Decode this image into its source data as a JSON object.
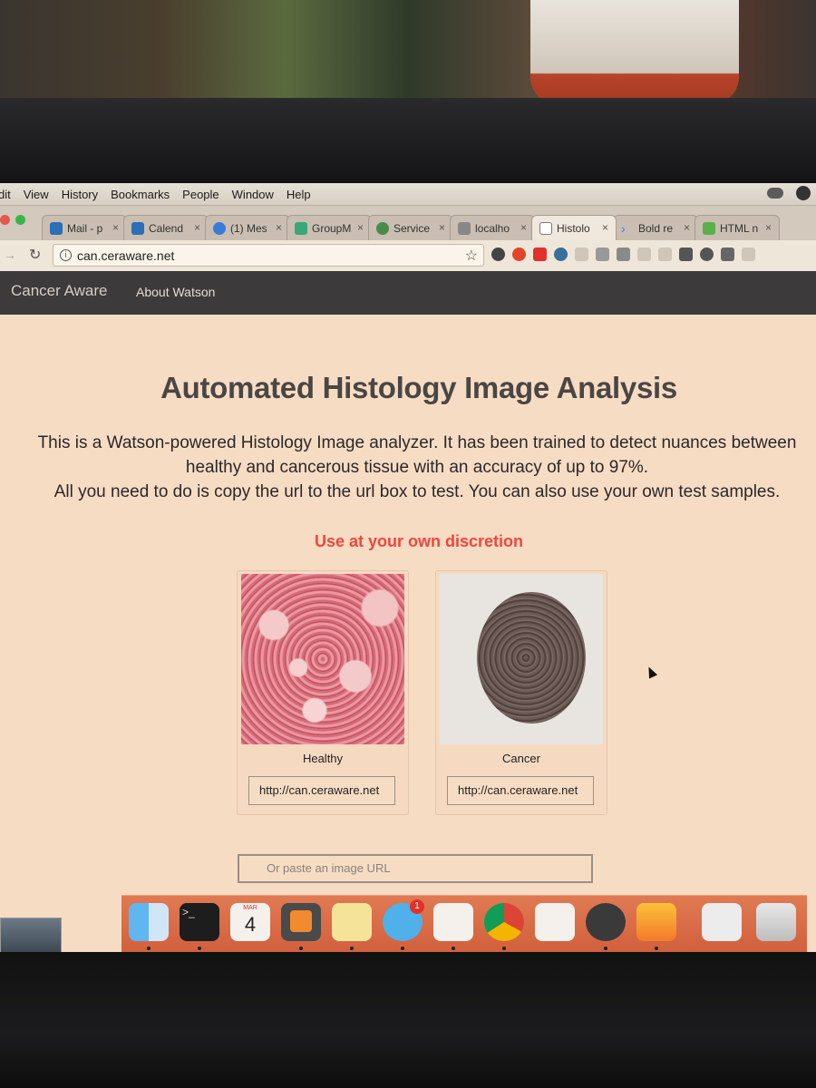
{
  "menubar": {
    "items": [
      "dit",
      "View",
      "History",
      "Bookmarks",
      "People",
      "Window",
      "Help"
    ]
  },
  "tabs": [
    {
      "label": "Mail - p",
      "favicon_color": "#2a6fb8"
    },
    {
      "label": "Calend",
      "favicon_color": "#2a6fb8"
    },
    {
      "label": "(1) Mes",
      "favicon_color": "#3b7bd8"
    },
    {
      "label": "GroupM",
      "favicon_color": "#3aa67a"
    },
    {
      "label": "Service",
      "favicon_color": "#4a8a4a"
    },
    {
      "label": "localho",
      "favicon_color": "#888888"
    },
    {
      "label": "Histolo",
      "favicon_color": "#dddddd",
      "active": true
    },
    {
      "label": "Bold re",
      "favicon_color": "#3b7bd8"
    },
    {
      "label": "HTML n",
      "favicon_color": "#5ab04a"
    }
  ],
  "tab_close": "×",
  "toolbar": {
    "url": "can.ceraware.net",
    "info_icon": "info-icon",
    "star_icon": "star-icon"
  },
  "site": {
    "brand": "Cancer Aware",
    "nav_about": "About Watson",
    "title": "Automated Histology Image Analysis",
    "description": "This is a Watson-powered Histology Image analyzer. It has been trained to detect nuances between healthy and cancerous tissue with an accuracy of up to 97%.",
    "instruction": "All you need to do is copy the url to the url box to test. You can also use your own test samples.",
    "warning": "Use at your own discretion",
    "samples": [
      {
        "label": "Healthy",
        "url": "http://can.ceraware.net"
      },
      {
        "label": "Cancer",
        "url": "http://can.ceraware.net"
      }
    ],
    "paste_placeholder": "Or paste an image URL"
  },
  "dock": {
    "calendar_month": "MAR",
    "calendar_day": "4",
    "messages_badge": "1",
    "apps": [
      "finder",
      "terminal",
      "calendar",
      "sublime-text",
      "notes",
      "messages",
      "slack",
      "chrome",
      "reminders",
      "github",
      "sketch",
      "preview",
      "trash"
    ]
  },
  "colors": {
    "warning": "#f2453c",
    "page_bg": "#f7dcc4",
    "navbar": "#3c3a3b",
    "dock": "#d2603d"
  }
}
